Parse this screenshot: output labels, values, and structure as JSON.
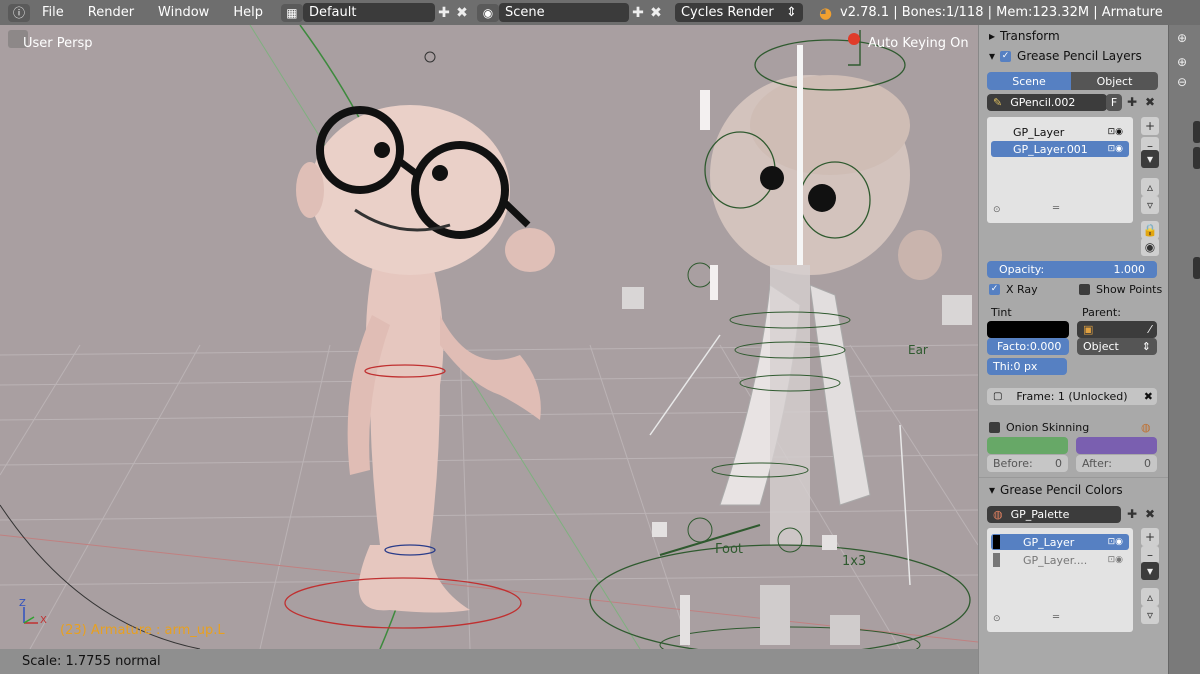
{
  "topbar": {
    "info_icon": "info-icon",
    "menus": [
      "File",
      "Render",
      "Window",
      "Help"
    ],
    "screen_layout": "Default",
    "scene": "Scene",
    "render_engine": "Cycles Render",
    "stats": "v2.78.1 | Bones:1/118 | Mem:123.32M | Armature"
  },
  "viewport": {
    "view_name": "User Persp",
    "auto_keying": "Auto Keying On",
    "active_object": "(23) Armature : arm_up.L",
    "axis_z": "Z",
    "axis_x": "X",
    "annotation_foot": "Foot",
    "annotation_1x3": "1x3",
    "annotation_ear": "Ear"
  },
  "status": {
    "scale_text": "Scale: 1.7755 normal"
  },
  "panel": {
    "transform_header": "Transform",
    "gp_layers_header": "Grease Pencil Layers",
    "tabs": [
      "Scene",
      "Object"
    ],
    "gpencil_name": "GPencil.002",
    "fake_user": "F",
    "layers": [
      "GP_Layer",
      "GP_Layer.001"
    ],
    "opacity_label": "Opacity:",
    "opacity_value": "1.000",
    "xray_label": "X Ray",
    "show_points_label": "Show Points",
    "tint_label": "Tint",
    "parent_label": "Parent:",
    "factor_label": "Facto:0.000",
    "parent_type": "Object",
    "thickness_label": "Thi:",
    "thickness_value": "0 px",
    "frame_label": "Frame: 1 (Unlocked)",
    "onion_label": "Onion Skinning",
    "before_label": "Before:",
    "before_value": "0",
    "after_label": "After:",
    "after_value": "0",
    "gp_colors_header": "Grease Pencil Colors",
    "palette_name": "GP_Palette",
    "colors": [
      "GP_Layer",
      "GP_Layer...."
    ]
  },
  "colors": {
    "accent": "#5680c2",
    "onion_before": "#67a867",
    "onion_after": "#7a5fb0",
    "tint": "#000000"
  }
}
